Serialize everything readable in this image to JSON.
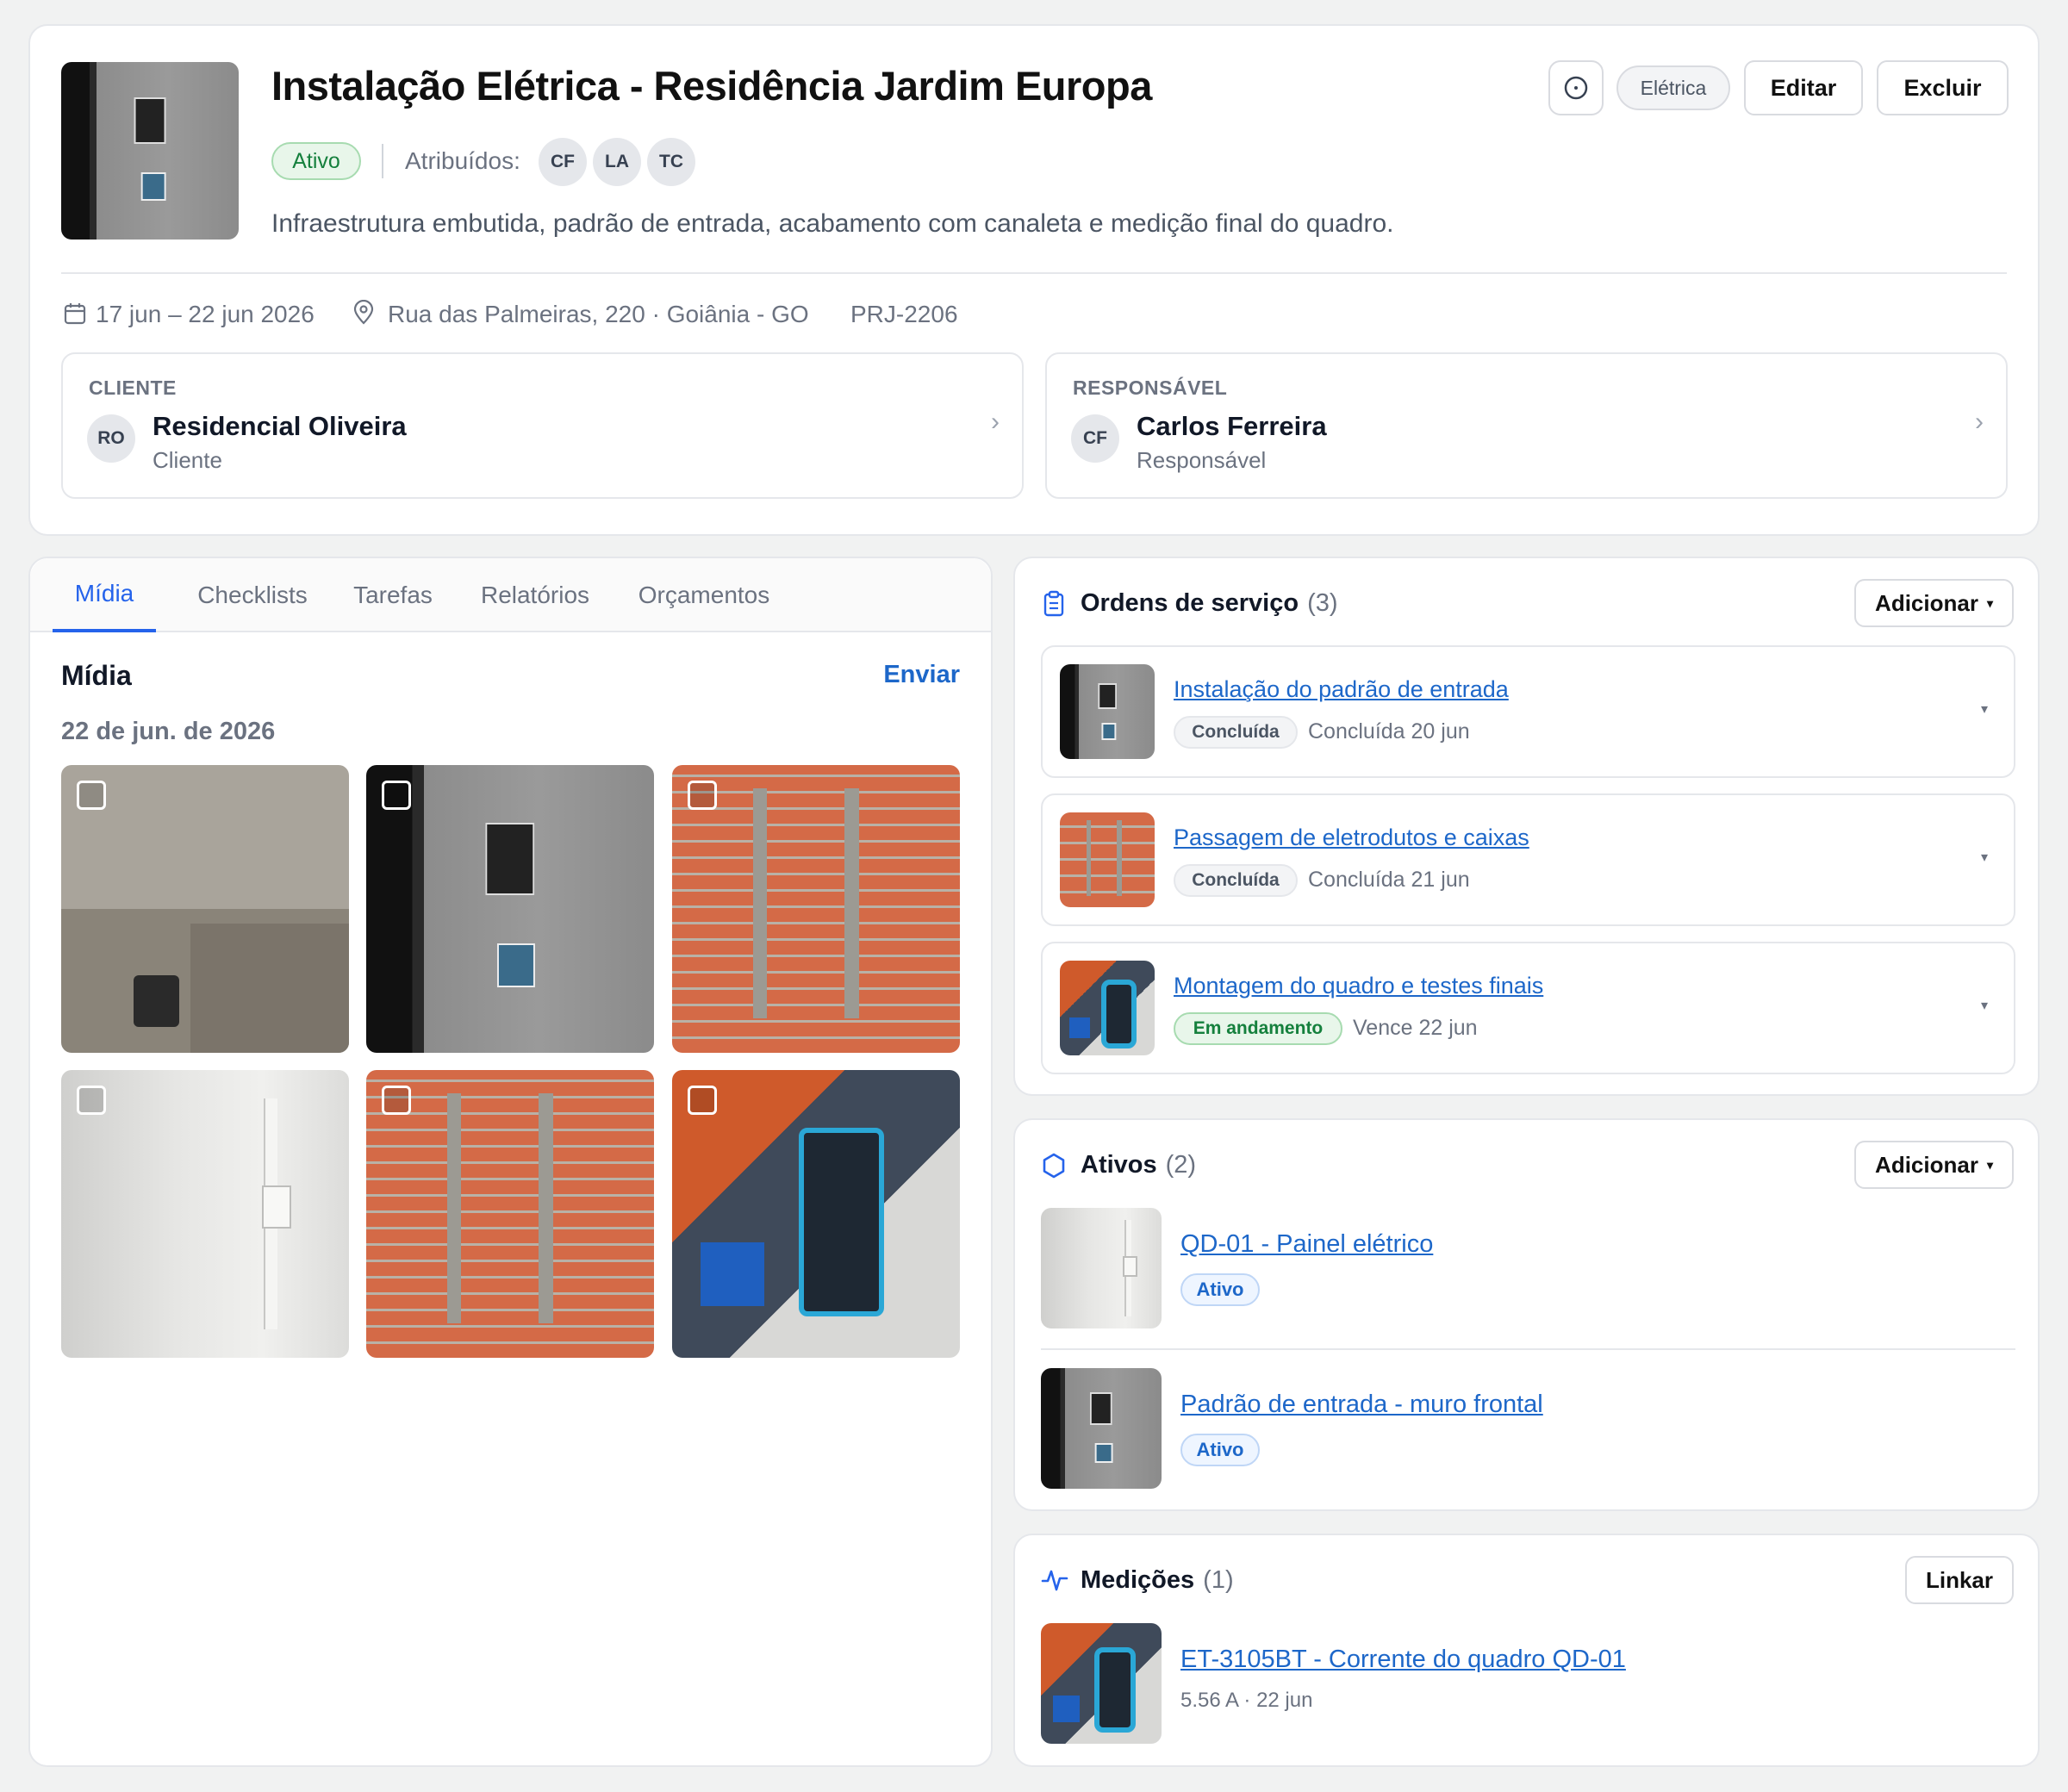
{
  "header": {
    "title": "Instalação Elétrica - Residência Jardim Europa",
    "status": "Ativo",
    "assigned_label": "Atribuídos:",
    "assignees": [
      "CF",
      "LA",
      "TC"
    ],
    "description": "Infraestrutura embutida, padrão de entrada, acabamento com canaleta e medição final do quadro.",
    "category": "Elétrica",
    "edit_label": "Editar",
    "delete_label": "Excluir",
    "dates": "17 jun – 22 jun 2026",
    "address": "Rua das Palmeiras, 220 · Goiânia - GO",
    "code": "PRJ-2206",
    "client": {
      "label": "CLIENTE",
      "initials": "RO",
      "name": "Residencial Oliveira",
      "role": "Cliente"
    },
    "responsible": {
      "label": "RESPONSÁVEL",
      "initials": "CF",
      "name": "Carlos Ferreira",
      "role": "Responsável"
    }
  },
  "tabs": [
    "Mídia",
    "Checklists",
    "Tarefas",
    "Relatórios",
    "Orçamentos"
  ],
  "media": {
    "title": "Mídia",
    "send_label": "Enviar",
    "date": "22 de jun. de 2026",
    "photos": [
      "room",
      "meter",
      "brick",
      "wall",
      "brick",
      "clamp"
    ]
  },
  "orders": {
    "title": "Ordens de serviço",
    "count": "(3)",
    "add_label": "Adicionar",
    "items": [
      {
        "name": "Instalação do padrão de entrada",
        "status": "Concluída",
        "note": "Concluída 20 jun"
      },
      {
        "name": "Passagem de eletrodutos e caixas",
        "status": "Concluída",
        "note": "Concluída 21 jun"
      },
      {
        "name": "Montagem do quadro e testes finais",
        "status": "Em andamento",
        "note": "Vence 22 jun"
      }
    ]
  },
  "assets": {
    "title": "Ativos",
    "count": "(2)",
    "add_label": "Adicionar",
    "items": [
      {
        "name": "QD-01 - Painel elétrico",
        "status": "Ativo"
      },
      {
        "name": "Padrão de entrada - muro frontal",
        "status": "Ativo"
      }
    ]
  },
  "measurements": {
    "title": "Medições",
    "count": "(1)",
    "link_label": "Linkar",
    "items": [
      {
        "name": "ET-3105BT - Corrente do quadro QD-01",
        "detail": "5.56 A · 22 jun"
      }
    ]
  },
  "colors": {
    "accent": "#2563eb",
    "link": "#1d67c9",
    "success": "#15803d"
  }
}
